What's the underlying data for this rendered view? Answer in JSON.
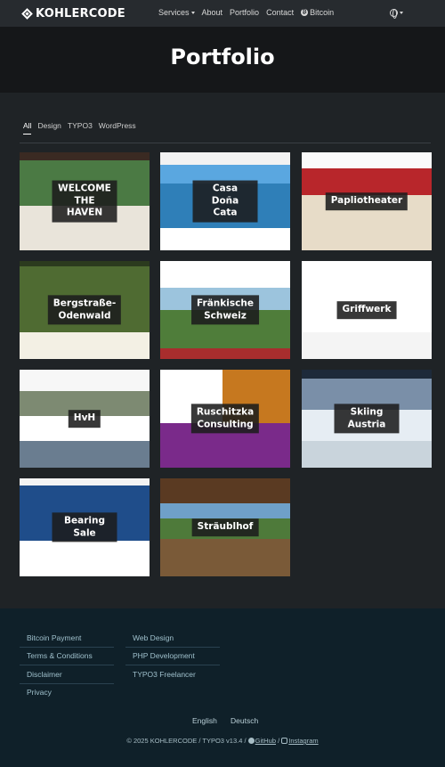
{
  "brand": {
    "name": "KOHLERCODE"
  },
  "nav": {
    "services": "Services",
    "about": "About",
    "portfolio": "Portfolio",
    "contact": "Contact",
    "bitcoin": "Bitcoin"
  },
  "hero": {
    "title": "Portfolio"
  },
  "filters": [
    "All",
    "Design",
    "TYPO3",
    "WordPress"
  ],
  "cards": [
    {
      "label": "WELCOME\nTHE HAVEN"
    },
    {
      "label": "Casa Doña Cata"
    },
    {
      "label": "Papliotheater"
    },
    {
      "label": "Bergstraße-\nOdenwald"
    },
    {
      "label": "Fränkische Schweiz"
    },
    {
      "label": "Griffwerk"
    },
    {
      "label": "HvH"
    },
    {
      "label": "Ruschitzka\nConsulting"
    },
    {
      "label": "Skiing Austria"
    },
    {
      "label": "Bearing Sale"
    },
    {
      "label": "Sträublhof"
    }
  ],
  "footer": {
    "col1": [
      "Bitcoin Payment",
      "Terms & Conditions",
      "Disclaimer",
      "Privacy"
    ],
    "col2": [
      "Web Design",
      "PHP Development",
      "TYPO3 Freelancer"
    ],
    "lang_en": "English",
    "lang_de": "Deutsch",
    "copyright": "© 2025 KOHLERCODE",
    "typo3": "TYPO3 v13.4",
    "github": "GitHub",
    "instagram": "Instagram"
  },
  "colors": {
    "page_bg": "#1f2326",
    "hero_bg": "#151719",
    "footer_bg": "#0f2029",
    "footer_link": "#9fc0cc"
  }
}
